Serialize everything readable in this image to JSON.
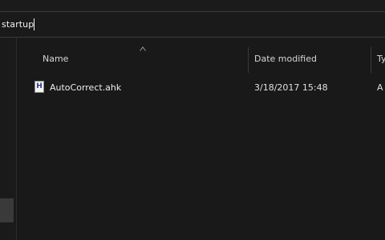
{
  "address_bar": {
    "path": "startup"
  },
  "columns": {
    "name": "Name",
    "date_modified": "Date modified",
    "type": "Ty"
  },
  "files": [
    {
      "icon": "ahk-script-icon",
      "icon_glyph": "H",
      "name": "AutoCorrect.ahk",
      "date_modified": "3/18/2017 15:48",
      "type": "A"
    }
  ]
}
